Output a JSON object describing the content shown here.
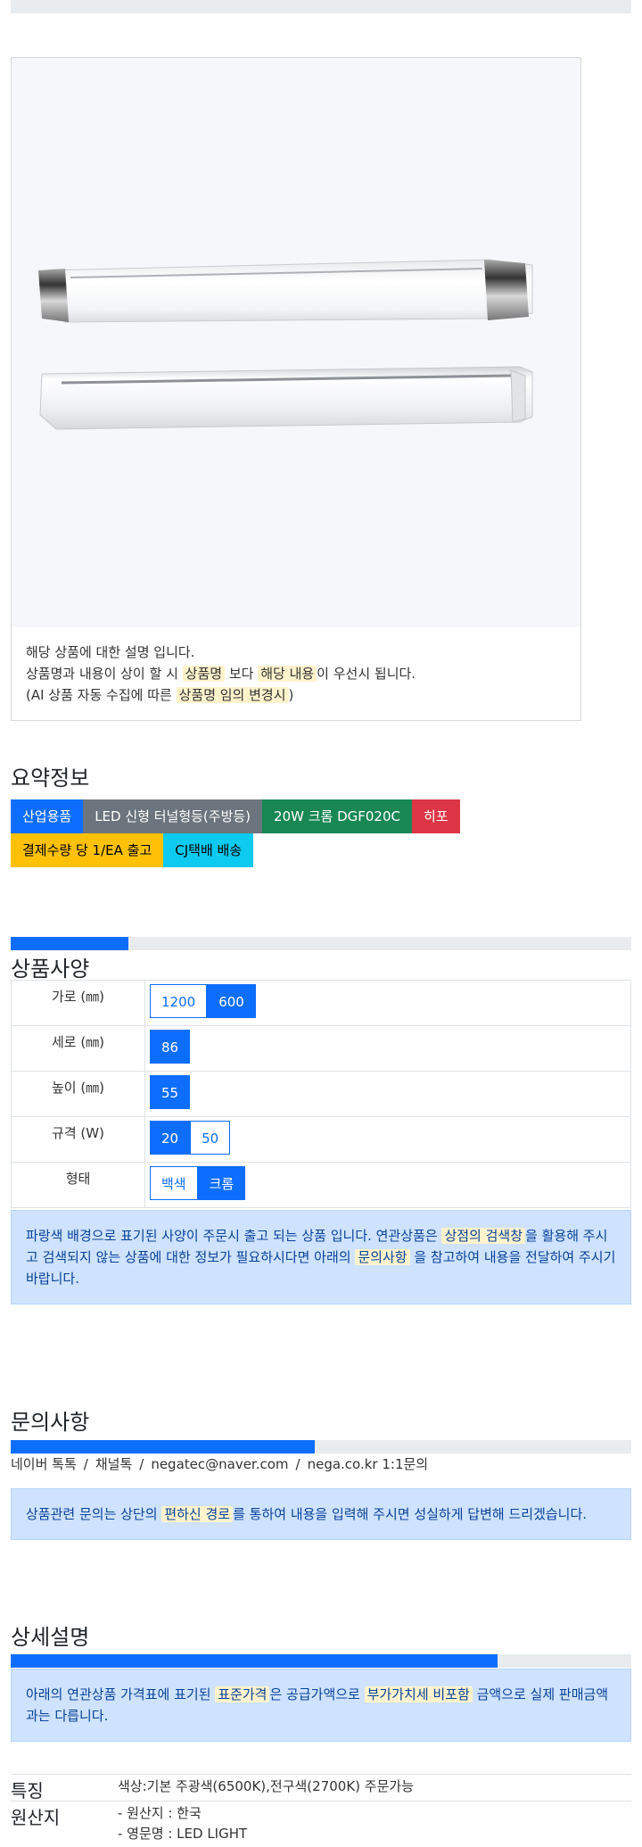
{
  "description": {
    "line1": "해당 상품에 대한 설명 입니다.",
    "line2_pre": "상품명과 내용이 상이 할 시 ",
    "line2_hl1": "상품명",
    "line2_mid": " 보다 ",
    "line2_hl2": "해당 내용",
    "line2_post": "이 우선시 됩니다.",
    "line3_pre": "(AI 상품 자동 수집에 따른 ",
    "line3_hl": "상품명 임의 변경시",
    "line3_post": ")"
  },
  "summary": {
    "title": "요약정보",
    "badges_row1": [
      {
        "label": "산업용품",
        "color": "#0d6efd"
      },
      {
        "label": "LED 신형 터널형등(주방등)",
        "color": "#6c757d"
      },
      {
        "label": "20W 크롬 DGF020C",
        "color": "#198754"
      },
      {
        "label": "히포",
        "color": "#dc3545"
      }
    ],
    "badges_row2": [
      {
        "label": "결제수량 당 1/EA 출고",
        "color": "#ffc107"
      },
      {
        "label": "CJ택배 배송",
        "color": "#0dcaf0"
      }
    ]
  },
  "spec": {
    "title": "상품사양",
    "progress_fraction": 0.19,
    "rows": [
      {
        "label": "가로 (㎜)",
        "options": [
          {
            "text": "1200",
            "selected": false
          },
          {
            "text": "600",
            "selected": true
          }
        ]
      },
      {
        "label": "세로 (㎜)",
        "options": [
          {
            "text": "86",
            "selected": true
          }
        ]
      },
      {
        "label": "높이 (㎜)",
        "options": [
          {
            "text": "55",
            "selected": true
          }
        ]
      },
      {
        "label": "규격 (W)",
        "options": [
          {
            "text": "20",
            "selected": true
          },
          {
            "text": "50",
            "selected": false
          }
        ]
      },
      {
        "label": "형태",
        "options": [
          {
            "text": "백색",
            "selected": false
          },
          {
            "text": "크롬",
            "selected": true
          }
        ]
      }
    ],
    "notice_pre": "파랑색 배경으로 표기된 사양이 주문시 출고 되는 상품 입니다. 연관상품은 ",
    "notice_hl1": "상점의 검색창",
    "notice_mid": "을 활용해 주시고 검색되지 않는 상품에 대한 정보가 필요하시다면 아래의 ",
    "notice_hl2": "문의사항",
    "notice_post": " 을 참고하여 내용을 전달하여 주시기 바랍니다."
  },
  "inquiry": {
    "title": "문의사항",
    "progress_fraction": 0.49,
    "contacts": [
      "네이버 톡톡",
      "채널톡",
      "negatec@naver.com",
      "nega.co.kr 1:1문의"
    ],
    "separator": "/",
    "notice_pre": "상품관련 문의는 상단의 ",
    "notice_hl": "편하신 경로",
    "notice_post": "를 통하여 내용을 입력해 주시면 성실하게 답변해 드리겠습니다."
  },
  "detail": {
    "title": "상세설명",
    "progress_fraction": 0.785,
    "notice_pre": "아래의 연관상품 가격표에 표기된 ",
    "notice_hl1": "표준가격",
    "notice_mid": "은 공급가액으로 ",
    "notice_hl2": "부가가치세 비포함",
    "notice_post": " 금액으로 실제 판매금액과는 다릅니다.",
    "rows": [
      {
        "key": "특징",
        "lines": [
          "색상:기본 주광색(6500K),전구색(2700K) 주문가능"
        ]
      },
      {
        "key": "원산지",
        "lines": [
          "- 원산지 : 한국",
          "- 영문명 : LED LIGHT"
        ]
      }
    ]
  }
}
